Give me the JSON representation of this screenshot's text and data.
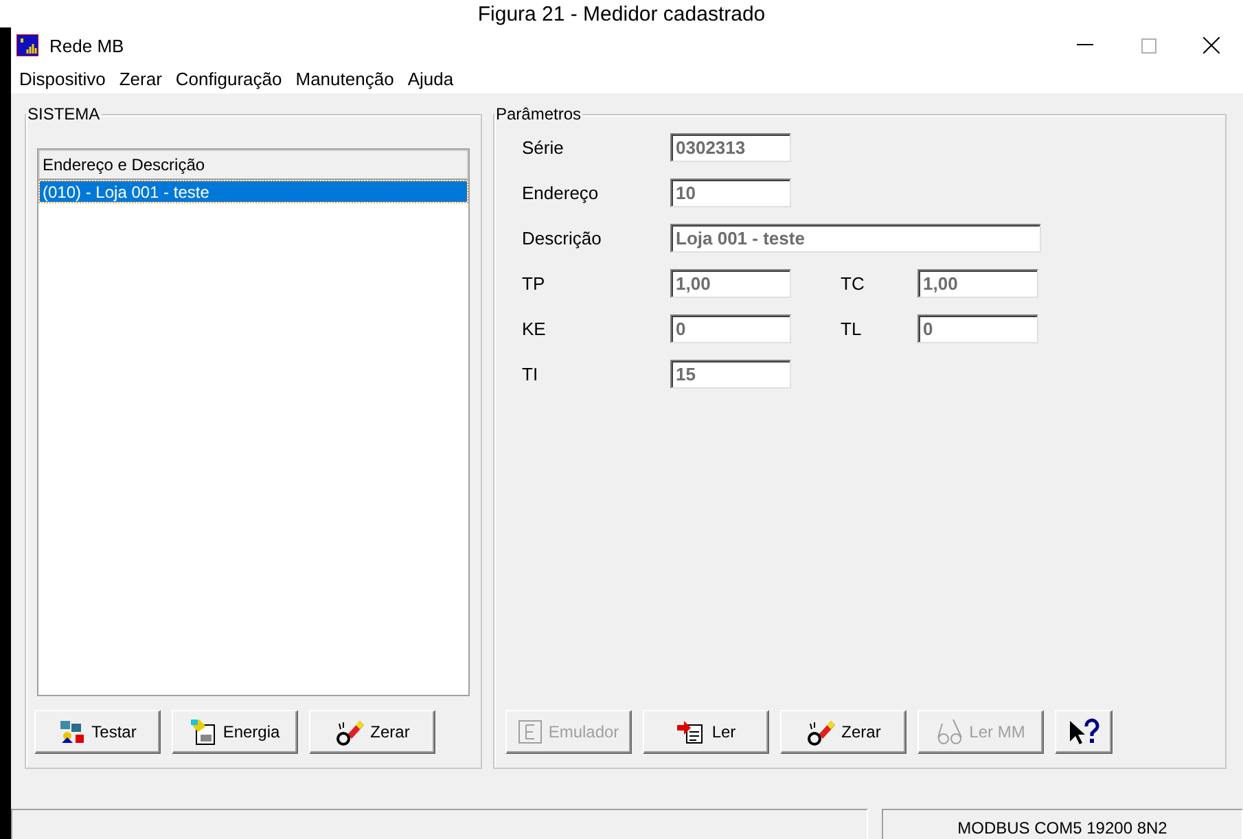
{
  "caption": "Figura 21 - Medidor cadastrado",
  "window": {
    "title": "Rede MB"
  },
  "menu": [
    "Dispositivo",
    "Zerar",
    "Configuração",
    "Manutenção",
    "Ajuda"
  ],
  "system": {
    "title": "SISTEMA",
    "list_header": "Endereço e Descrição",
    "items": [
      {
        "label": "(010) - Loja 001 - teste",
        "selected": true
      }
    ],
    "buttons": [
      {
        "label": "Testar",
        "disabled": false
      },
      {
        "label": "Energia",
        "disabled": false
      },
      {
        "label": "Zerar",
        "disabled": false
      }
    ]
  },
  "parameters": {
    "title": "Parâmetros",
    "rows": [
      [
        {
          "label": "Série",
          "value": "0302313",
          "wide": false
        }
      ],
      [
        {
          "label": "Endereço",
          "value": "10",
          "wide": false
        }
      ],
      [
        {
          "label": "Descrição",
          "value": "Loja 001 - teste",
          "wide": true
        }
      ],
      [
        {
          "label": "TP",
          "value": "1,00",
          "wide": false
        },
        {
          "label": "TC",
          "value": "1,00",
          "wide": false
        }
      ],
      [
        {
          "label": "KE",
          "value": "0",
          "wide": false
        },
        {
          "label": "TL",
          "value": "0",
          "wide": false
        }
      ],
      [
        {
          "label": "TI",
          "value": "15",
          "wide": false
        }
      ]
    ],
    "buttons": [
      {
        "label": "Emulador",
        "disabled": true
      },
      {
        "label": "Ler",
        "disabled": false
      },
      {
        "label": "Zerar",
        "disabled": false
      },
      {
        "label": "Ler MM",
        "disabled": true
      },
      {
        "disabled": false
      }
    ]
  },
  "status_bar": {
    "connection": "MODBUS COM5 19200 8N2"
  }
}
